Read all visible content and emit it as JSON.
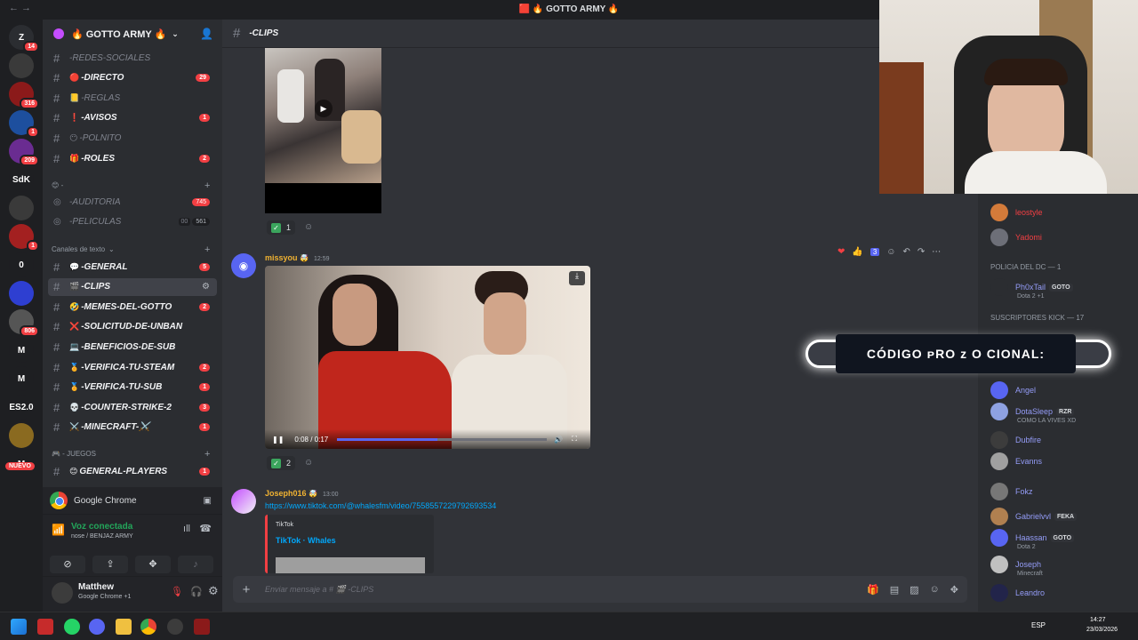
{
  "window": {
    "title": "GOTTO ARMY",
    "title_prefix_emojis": "🟥 🔥",
    "title_suffix_emoji": "🔥",
    "nav": "← →"
  },
  "servers": [
    {
      "label": "Z",
      "badge": "14"
    },
    {
      "label": "",
      "badge": ""
    },
    {
      "label": "",
      "badge": "316"
    },
    {
      "label": "",
      "badge": "1"
    },
    {
      "label": "",
      "badge": "209"
    },
    {
      "label": "SdK",
      "badge": ""
    },
    {
      "label": "",
      "badge": ""
    },
    {
      "label": "",
      "badge": "1"
    },
    {
      "label": "0",
      "badge": ""
    },
    {
      "label": "",
      "badge": ""
    },
    {
      "label": "",
      "badge": "806"
    },
    {
      "label": "M",
      "badge": ""
    },
    {
      "label": "M",
      "badge": ""
    },
    {
      "label": "ES2.0",
      "badge": ""
    },
    {
      "label": "",
      "badge": ""
    },
    {
      "label": "M",
      "badge": ""
    }
  ],
  "nuevo": "NUEVO",
  "guild": {
    "name": "🔥 GOTTO ARMY 🔥"
  },
  "channels": [
    {
      "name": "-REDES-SOCIALES",
      "emoji": "",
      "badge": "",
      "muted": true
    },
    {
      "name": "-DIRECTO",
      "emoji": "🔴",
      "badge": "29",
      "muted": false
    },
    {
      "name": "-REGLAS",
      "emoji": "📒",
      "badge": "",
      "muted": true
    },
    {
      "name": "-AVISOS",
      "emoji": "❗",
      "badge": "1",
      "muted": false
    },
    {
      "name": "-POLNITO",
      "emoji": "😶",
      "badge": "",
      "muted": true
    },
    {
      "name": "-ROLES",
      "emoji": "🎁",
      "badge": "2",
      "muted": false
    }
  ],
  "voice_category": "😊 -",
  "voice_channels": [
    {
      "name": "-AUDITORIA",
      "badge": "745"
    },
    {
      "name": "-PELICULAS",
      "badge": "561",
      "extra": "00"
    }
  ],
  "text_category": "Canales de texto",
  "text_channels": [
    {
      "name": "-GENERAL",
      "emoji": "💬",
      "badge": "5"
    },
    {
      "name": "-CLIPS",
      "emoji": "🎬",
      "badge": "",
      "selected": true
    },
    {
      "name": "-MEMES-DEL-GOTTO",
      "emoji": "🤣",
      "badge": "2"
    },
    {
      "name": "-SOLICITUD-DE-UNBAN",
      "emoji": "❌",
      "badge": ""
    },
    {
      "name": "-BENEFICIOS-DE-SUB",
      "emoji": "💻",
      "badge": ""
    },
    {
      "name": "-VERIFICA-TU-STEAM",
      "emoji": "🏅",
      "badge": "2"
    },
    {
      "name": "-VERIFICA-TU-SUB",
      "emoji": "🏅",
      "badge": "1"
    },
    {
      "name": "-COUNTER-STRIKE-2",
      "emoji": "💀",
      "badge": "3"
    },
    {
      "name": "-MINECRAFT-⚔️",
      "emoji": "⚔️",
      "badge": "1"
    }
  ],
  "games_category": "🎮 - JUEGOS",
  "games_channels": [
    {
      "name": "GENERAL-PLAYERS",
      "emoji": "😊",
      "badge": "1"
    }
  ],
  "chrome_bar": {
    "label": "Google Chrome"
  },
  "voice": {
    "status": "Voz conectada",
    "channel": "nose / BENJAZ ARMY"
  },
  "user": {
    "name": "Matthew",
    "status": "Google Chrome +1"
  },
  "chat": {
    "channel": "-CLIPS",
    "reaction1": {
      "emoji": "✅",
      "count": "1"
    },
    "message2": {
      "author": "missyou",
      "time": "12:59",
      "video_time": "0:08 / 0:17",
      "progress": 0.48,
      "reactions_hover": [
        "❤️",
        "👍",
        "3"
      ],
      "reaction": {
        "emoji": "✅",
        "count": "2"
      }
    },
    "message3": {
      "author": "Joseph016",
      "time": "13:00",
      "link": "https://www.tiktok.com/@whalesfm/video/7558557229792693534",
      "embed_provider": "TikTok",
      "embed_title": "TikTok · Whales"
    },
    "composer_placeholder": "Enviar mensaje a # 🎬 -CLIPS"
  },
  "overlay_text": "CÓDIGO ᴘRO ᴢ O CIONAL:",
  "members": [
    {
      "name": "leostyle",
      "color": "#f23f43",
      "tag": "",
      "sub": ""
    },
    {
      "name": "Yadomi",
      "color": "#f23f43",
      "tag": "",
      "sub": ""
    },
    {
      "name": "Ph0xTail",
      "color": "#949cf7",
      "tag": "GOTO",
      "sub": "Dota 2 +1"
    },
    {
      "name": "Angel",
      "color": "#949cf7",
      "tag": "",
      "sub": ""
    },
    {
      "name": "DotaSleep",
      "color": "#949cf7",
      "tag": "RZR",
      "sub": "COMO LA VIVES XD"
    },
    {
      "name": "Dubfire",
      "color": "#949cf7",
      "tag": "",
      "sub": ""
    },
    {
      "name": "Evanns",
      "color": "#949cf7",
      "tag": "",
      "sub": ""
    },
    {
      "name": "Fokz",
      "color": "#949cf7",
      "tag": "",
      "sub": ""
    },
    {
      "name": "Gabrielvvl",
      "color": "#949cf7",
      "tag": "FEKA",
      "sub": ""
    },
    {
      "name": "Haassan",
      "color": "#949cf7",
      "tag": "GOTO",
      "sub": "Dota 2"
    },
    {
      "name": "Joseph",
      "color": "#949cf7",
      "tag": "",
      "sub": "Minecraft"
    },
    {
      "name": "Leandro",
      "color": "#949cf7",
      "tag": "",
      "sub": ""
    }
  ],
  "member_categories": [
    "POLICIA DEL DC — 1",
    "SUSCRIPTORES KICK — 17"
  ],
  "taskbar": {
    "lang": "ESP",
    "time": "14:27",
    "date": "23/03/2026"
  }
}
